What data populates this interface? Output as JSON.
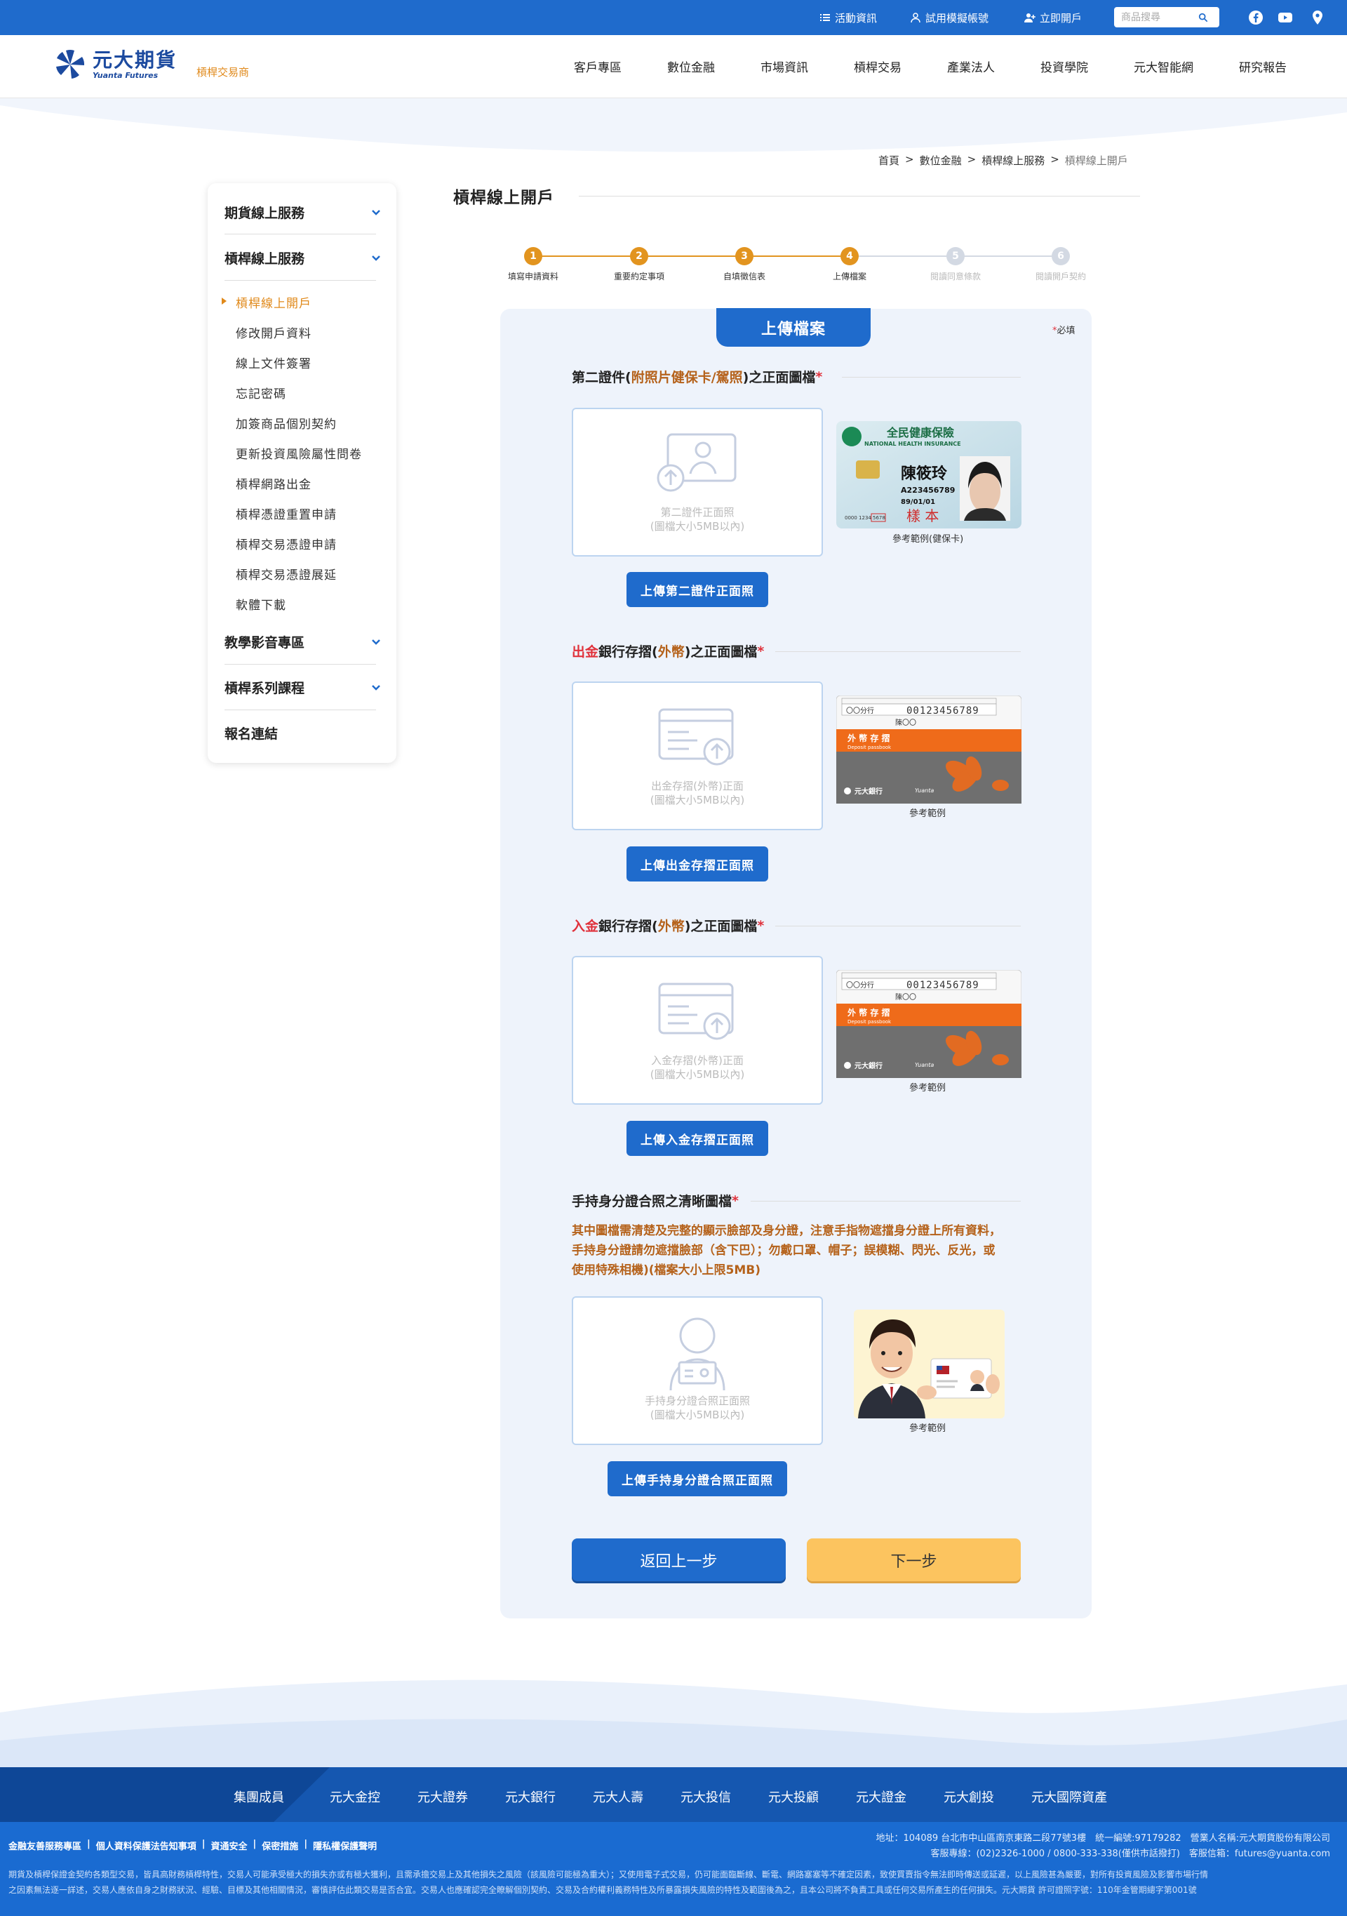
{
  "topbar": {
    "activity": "活動資訊",
    "trial": "試用模擬帳號",
    "open": "立即開戶",
    "search_placeholder": "商品搜尋"
  },
  "logo": {
    "cn": "元大期貨",
    "en": "Yuanta Futures",
    "sub": "槓桿交易商"
  },
  "nav": [
    "客戶專區",
    "數位金融",
    "市場資訊",
    "槓桿交易",
    "產業法人",
    "投資學院",
    "元大智能網",
    "研究報告"
  ],
  "breadcrumb": [
    "首頁",
    ">",
    "數位金融",
    ">",
    "槓桿線上服務",
    ">",
    "槓桿線上開戶"
  ],
  "sidebar": {
    "groups": [
      "期貨線上服務",
      "槓桿線上服務",
      "教學影音專區",
      "槓桿系列課程",
      "報名連結"
    ],
    "items": [
      "槓桿線上開戶",
      "修改開戶資料",
      "線上文件簽署",
      "忘記密碼",
      "加簽商品個別契約",
      "更新投資風險屬性問卷",
      "槓桿網路出金",
      "槓桿憑證重置申請",
      "槓桿交易憑證申請",
      "槓桿交易憑證展延",
      "軟體下載"
    ]
  },
  "page_title": "槓桿線上開戶",
  "steps": [
    {
      "num": "1",
      "label": "填寫申請資料"
    },
    {
      "num": "2",
      "label": "重要約定事項"
    },
    {
      "num": "3",
      "label": "自填徵信表"
    },
    {
      "num": "4",
      "label": "上傳檔案"
    },
    {
      "num": "5",
      "label": "閱讀同意條款"
    },
    {
      "num": "6",
      "label": "閱讀開戶契約"
    }
  ],
  "panel": {
    "tab": "上傳檔案",
    "required_star": "*",
    "required": "必填",
    "star": "*"
  },
  "sections": {
    "s1": {
      "a": "第二證件(",
      "b": "附照片健保卡/駕照",
      "c": ")之正面圖檔",
      "hint1": "第二證件正面照",
      "hint2": "(圖檔大小5MB以內)",
      "button": "上傳第二證件正面照",
      "ref": "參考範例(健保卡)"
    },
    "s2": {
      "a": "出金",
      "b": "銀行存摺(",
      "c": "外幣",
      "d": ")之正面圖檔",
      "hint1": "出金存摺(外幣)正面",
      "hint2": "(圖檔大小5MB以內)",
      "button": "上傳出金存摺正面照",
      "ref": "參考範例"
    },
    "s3": {
      "a": "入金",
      "b": "銀行存摺(",
      "c": "外幣",
      "d": ")之正面圖檔",
      "hint1": "入金存摺(外幣)正面",
      "hint2": "(圖檔大小5MB以內)",
      "button": "上傳入金存摺正面照",
      "ref": "參考範例"
    },
    "s4": {
      "a": "手持身分證合照之清晰圖檔",
      "warn1": "其中圖檔需清楚及完整的顯示臉部及身分證，注意手指物遮擋身分證上所有資料，",
      "warn2": "手持身分證請勿遮擋臉部（含下巴）；勿戴口罩、帽子；誤模糊、閃光、反光，或",
      "warn3": "使用特殊相機)(檔案大小上限5MB)",
      "hint1": "手持身分證合照正面照",
      "hint2": "(圖檔大小5MB以內)",
      "button": "上傳手持身分證合照正面照",
      "ref": "參考範例"
    }
  },
  "sample_card": {
    "title_cn": "全民健康保險",
    "title_en": "NATIONAL HEALTH INSURANCE",
    "name": "陳筱玲",
    "id": "A223456789",
    "dob": "89/01/01",
    "stamp": "樣 本",
    "card_no": "0000 1234",
    "card_no2": "5678"
  },
  "sample_passbook": {
    "account": "00123456789",
    "branch": "〇〇分行",
    "holder": "陳〇〇",
    "label_cn": "外 幣 存 摺",
    "label_en": "Deposit passbook",
    "bank": "元大銀行",
    "brand": "Yuanta"
  },
  "buttons": {
    "prev": "返回上一步",
    "next": "下一步"
  },
  "footer": {
    "member": "集團成員",
    "companies": [
      "元大金控",
      "元大證券",
      "元大銀行",
      "元大人壽",
      "元大投信",
      "元大投顧",
      "元大證金",
      "元大創投",
      "元大國際資產"
    ],
    "links": [
      "金融友善服務專區",
      "|",
      "個人資料保護法告知事項",
      "|",
      "資通安全",
      "|",
      "保密措施",
      "|",
      "隱私權保護聲明"
    ],
    "address": "地址：104089 台北市中山區南京東路二段77號3樓　統一編號:97179282　營業人名稱:元大期貨股份有限公司",
    "contact": "客服專線：(02)2326-1000 / 0800-333-338(僅供市話撥打)　客服信箱：futures@yuanta.com",
    "disclaimer1": "期貨及槓桿保證金契約各類型交易，皆具高財務槓桿特性，交易人可能承受極大的損失亦或有極大獲利，且需承擔交易上及其他損失之風險（該風險可能極為重大）；又使用電子式交易，仍可能面臨斷線、斷電、網路塞塞等不確定因素，致使買賣指令無法即時傳送或延遲，以上風險甚為嚴要，對所有投資風險及影響市場行情",
    "disclaimer2": "之因素無法逐一詳述，交易人應依自身之財務狀況、經驗、目標及其他相關情況，審慎評估此類交易是否合宜。交易人也應確認完全瞭解個別契約、交易及合約權利義務特性及所暴露損失風險的特性及範圍後為之，且本公司將不負責工具或任何交易所產生的任何損失。元大期貨 許可證照字號：110年金管期總字第001號"
  },
  "colors": {
    "brand": "#1f6bcc",
    "accent": "#e0891a",
    "step_active": "#e2941f",
    "step_inactive": "#d3d9e3",
    "next_button": "#fcc45f",
    "required": "#e0323c"
  }
}
